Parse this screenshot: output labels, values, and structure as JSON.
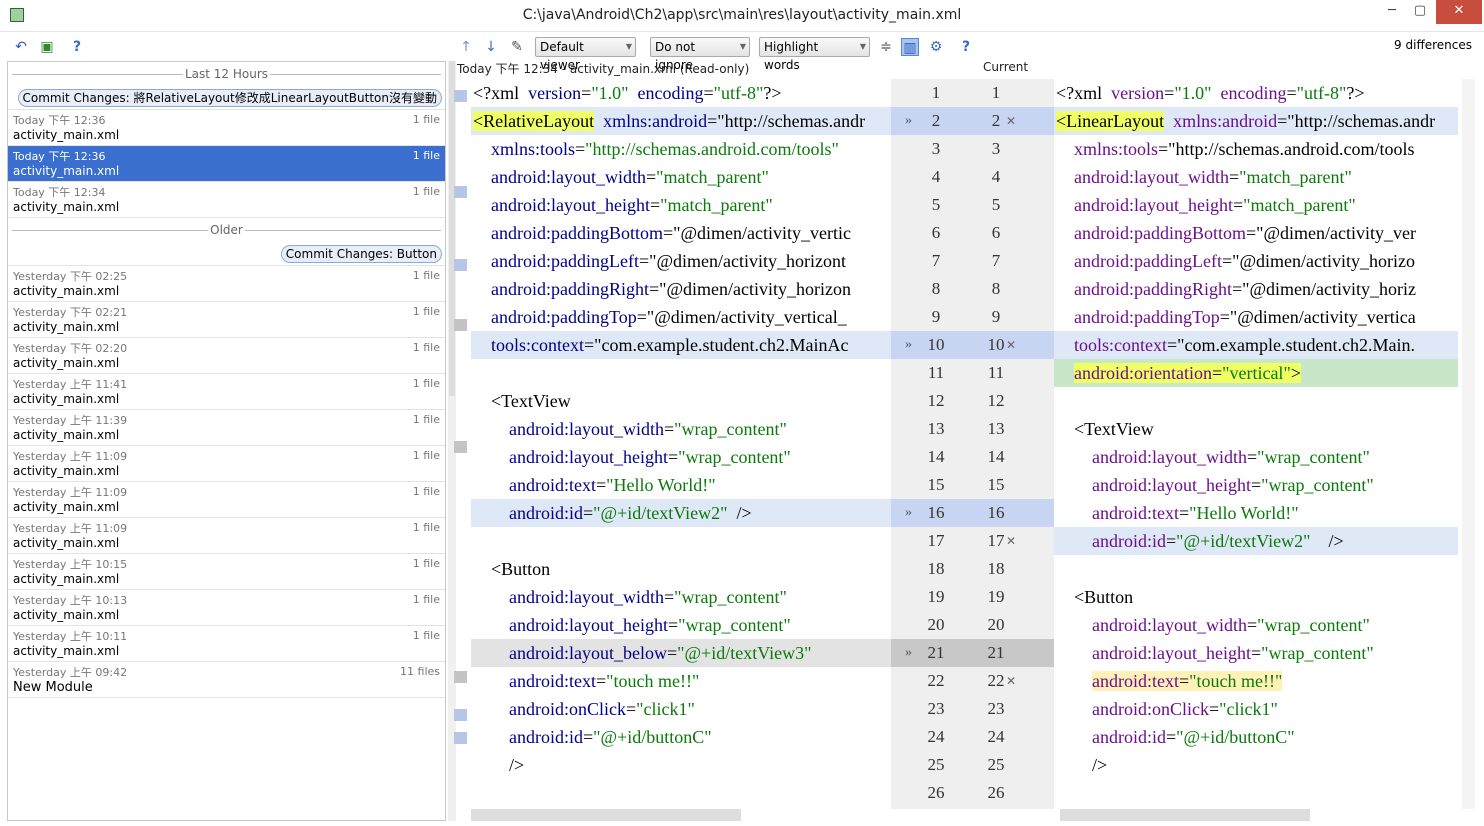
{
  "window": {
    "title": "C:\\java\\Android\\Ch2\\app\\src\\main\\res\\layout\\activity_main.xml",
    "minimize": "─",
    "maximize": "▢",
    "close": "✕"
  },
  "toolbar": {
    "viewer": "Default viewer",
    "ignore": "Do not ignore",
    "highlight": "Highlight words",
    "differences": "9 differences"
  },
  "history": {
    "group1": "Last 12 Hours",
    "commit1": "Commit Changes: 將RelativeLayout修改成LinearLayoutButton沒有變動",
    "entries1": [
      {
        "date": "Today 下午 12:36",
        "file": "activity_main.xml",
        "count": "1 file"
      },
      {
        "date": "Today 下午 12:36",
        "file": "activity_main.xml",
        "count": "1 file"
      },
      {
        "date": "Today 下午 12:34",
        "file": "activity_main.xml",
        "count": "1 file"
      }
    ],
    "group2": "Older",
    "commit2": "Commit Changes: Button",
    "entries2": [
      {
        "date": "Yesterday 下午 02:25",
        "file": "activity_main.xml",
        "count": "1 file"
      },
      {
        "date": "Yesterday 下午 02:21",
        "file": "activity_main.xml",
        "count": "1 file"
      },
      {
        "date": "Yesterday 下午 02:20",
        "file": "activity_main.xml",
        "count": "1 file"
      },
      {
        "date": "Yesterday 上午 11:41",
        "file": "activity_main.xml",
        "count": "1 file"
      },
      {
        "date": "Yesterday 上午 11:39",
        "file": "activity_main.xml",
        "count": "1 file"
      },
      {
        "date": "Yesterday 上午 11:09",
        "file": "activity_main.xml",
        "count": "1 file"
      },
      {
        "date": "Yesterday 上午 11:09",
        "file": "activity_main.xml",
        "count": "1 file"
      },
      {
        "date": "Yesterday 上午 11:09",
        "file": "activity_main.xml",
        "count": "1 file"
      },
      {
        "date": "Yesterday 上午 10:15",
        "file": "activity_main.xml",
        "count": "1 file"
      },
      {
        "date": "Yesterday 上午 10:13",
        "file": "activity_main.xml",
        "count": "1 file"
      },
      {
        "date": "Yesterday 上午 10:11",
        "file": "activity_main.xml",
        "count": "1 file"
      },
      {
        "date": "Yesterday 上午 09:42",
        "file": "New Module",
        "count": "11 files"
      }
    ]
  },
  "diff": {
    "leftHeader": "Today 下午 12:34 - activity_main.xml (Read-only)",
    "rightHeader": "Current",
    "left": [
      {
        "t": "<?xml  version=\"1.0\"  encoding=\"utf-8\"?>"
      },
      {
        "t": "<RelativeLayout  xmlns:android=\"http://schemas.andr"
      },
      {
        "t": "    xmlns:tools=\"http://schemas.android.com/tools\""
      },
      {
        "t": "    android:layout_width=\"match_parent\""
      },
      {
        "t": "    android:layout_height=\"match_parent\""
      },
      {
        "t": "    android:paddingBottom=\"@dimen/activity_vertic"
      },
      {
        "t": "    android:paddingLeft=\"@dimen/activity_horizont"
      },
      {
        "t": "    android:paddingRight=\"@dimen/activity_horizon"
      },
      {
        "t": "    android:paddingTop=\"@dimen/activity_vertical_"
      },
      {
        "t": "    tools:context=\"com.example.student.ch2.MainAc"
      },
      {
        "t": ""
      },
      {
        "t": "    <TextView"
      },
      {
        "t": "        android:layout_width=\"wrap_content\""
      },
      {
        "t": "        android:layout_height=\"wrap_content\""
      },
      {
        "t": "        android:text=\"Hello World!\""
      },
      {
        "t": "        android:id=\"@+id/textView2\"  />"
      },
      {
        "t": ""
      },
      {
        "t": "    <Button"
      },
      {
        "t": "        android:layout_width=\"wrap_content\""
      },
      {
        "t": "        android:layout_height=\"wrap_content\""
      },
      {
        "t": "        android:layout_below=\"@+id/textView3\""
      },
      {
        "t": "        android:text=\"touch me!!\""
      },
      {
        "t": "        android:onClick=\"click1\""
      },
      {
        "t": "        android:id=\"@+id/buttonC\""
      },
      {
        "t": "        />"
      },
      {
        "t": ""
      }
    ],
    "right": [
      {
        "t": "<?xml  version=\"1.0\"  encoding=\"utf-8\"?>"
      },
      {
        "t": "<LinearLayout  xmlns:android=\"http://schemas.andr"
      },
      {
        "t": "    xmlns:tools=\"http://schemas.android.com/tools"
      },
      {
        "t": "    android:layout_width=\"match_parent\""
      },
      {
        "t": "    android:layout_height=\"match_parent\""
      },
      {
        "t": "    android:paddingBottom=\"@dimen/activity_ver"
      },
      {
        "t": "    android:paddingLeft=\"@dimen/activity_horizo"
      },
      {
        "t": "    android:paddingRight=\"@dimen/activity_horiz"
      },
      {
        "t": "    android:paddingTop=\"@dimen/activity_vertica"
      },
      {
        "t": "    tools:context=\"com.example.student.ch2.Main."
      },
      {
        "t": "    android:orientation=\"vertical\">"
      },
      {
        "t": ""
      },
      {
        "t": "    <TextView"
      },
      {
        "t": "        android:layout_width=\"wrap_content\""
      },
      {
        "t": "        android:layout_height=\"wrap_content\""
      },
      {
        "t": "        android:text=\"Hello World!\""
      },
      {
        "t": "        android:id=\"@+id/textView2\"    />"
      },
      {
        "t": ""
      },
      {
        "t": "    <Button"
      },
      {
        "t": "        android:layout_width=\"wrap_content\""
      },
      {
        "t": "        android:layout_height=\"wrap_content\""
      },
      {
        "t": "        android:text=\"touch me!!\""
      },
      {
        "t": "        android:onClick=\"click1\""
      },
      {
        "t": "        android:id=\"@+id/buttonC\""
      },
      {
        "t": "        />"
      }
    ],
    "gutterLeft": [
      "1",
      "2",
      "3",
      "4",
      "5",
      "6",
      "7",
      "8",
      "9",
      "10",
      "11",
      "12",
      "13",
      "14",
      "15",
      "16",
      "17",
      "18",
      "19",
      "20",
      "21",
      "22",
      "23",
      "24",
      "25",
      "26"
    ],
    "gutterRight": [
      "1",
      "2",
      "3",
      "4",
      "5",
      "6",
      "7",
      "8",
      "9",
      "10",
      "11",
      "12",
      "13",
      "14",
      "15",
      "16",
      "17",
      "18",
      "19",
      "20",
      "21",
      "22",
      "23",
      "24",
      "25",
      "26"
    ]
  }
}
